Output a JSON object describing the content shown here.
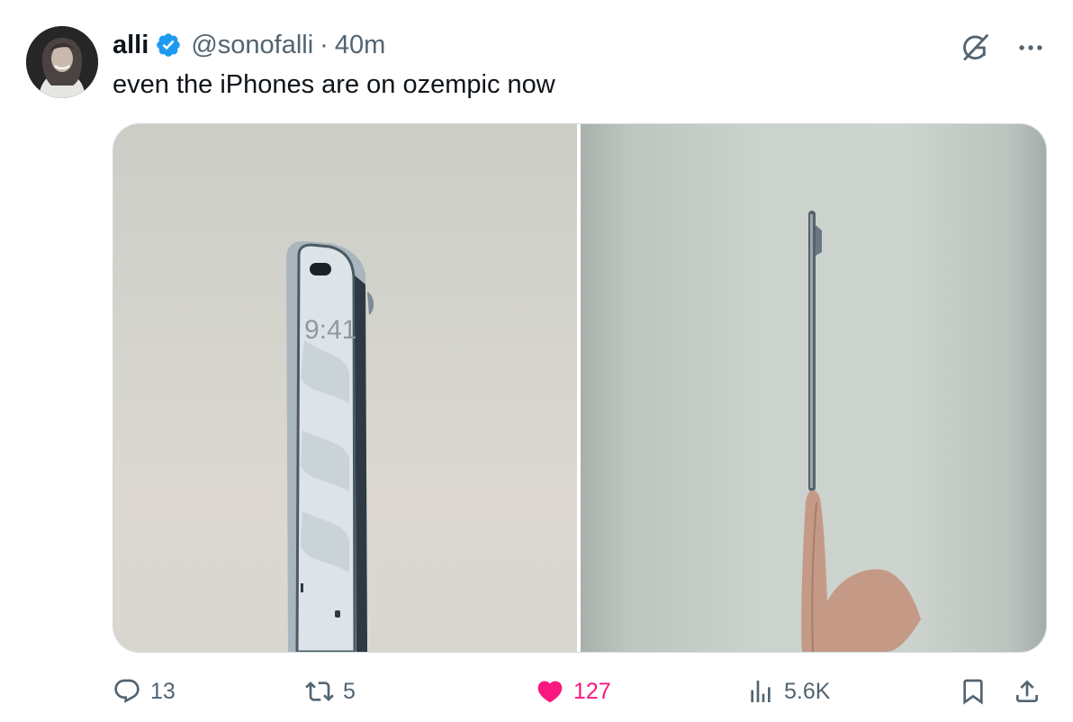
{
  "tweet": {
    "author": {
      "display_name": "alli",
      "handle": "@sonofalli",
      "verified": true,
      "avatar_icon": "profile-photo"
    },
    "separator": "·",
    "time": "40m",
    "text": "even the iPhones are on ozempic now",
    "media": {
      "count": 2,
      "left_phone_screen_time": "9:41"
    },
    "stats": {
      "replies": "13",
      "reposts": "5",
      "likes": "127",
      "views": "5.6K"
    },
    "liked": true
  },
  "icons": {
    "verified": "verified-badge-icon",
    "grok": "grok-icon",
    "more": "more-options-icon",
    "reply": "reply-icon",
    "repost": "repost-icon",
    "like": "heart-icon",
    "views": "views-icon",
    "bookmark": "bookmark-icon",
    "share": "share-icon"
  },
  "colors": {
    "text_primary": "#0f1419",
    "text_secondary": "#536471",
    "verified_blue": "#1d9bf0",
    "like_pink": "#f91880",
    "border": "#cfd9de"
  }
}
